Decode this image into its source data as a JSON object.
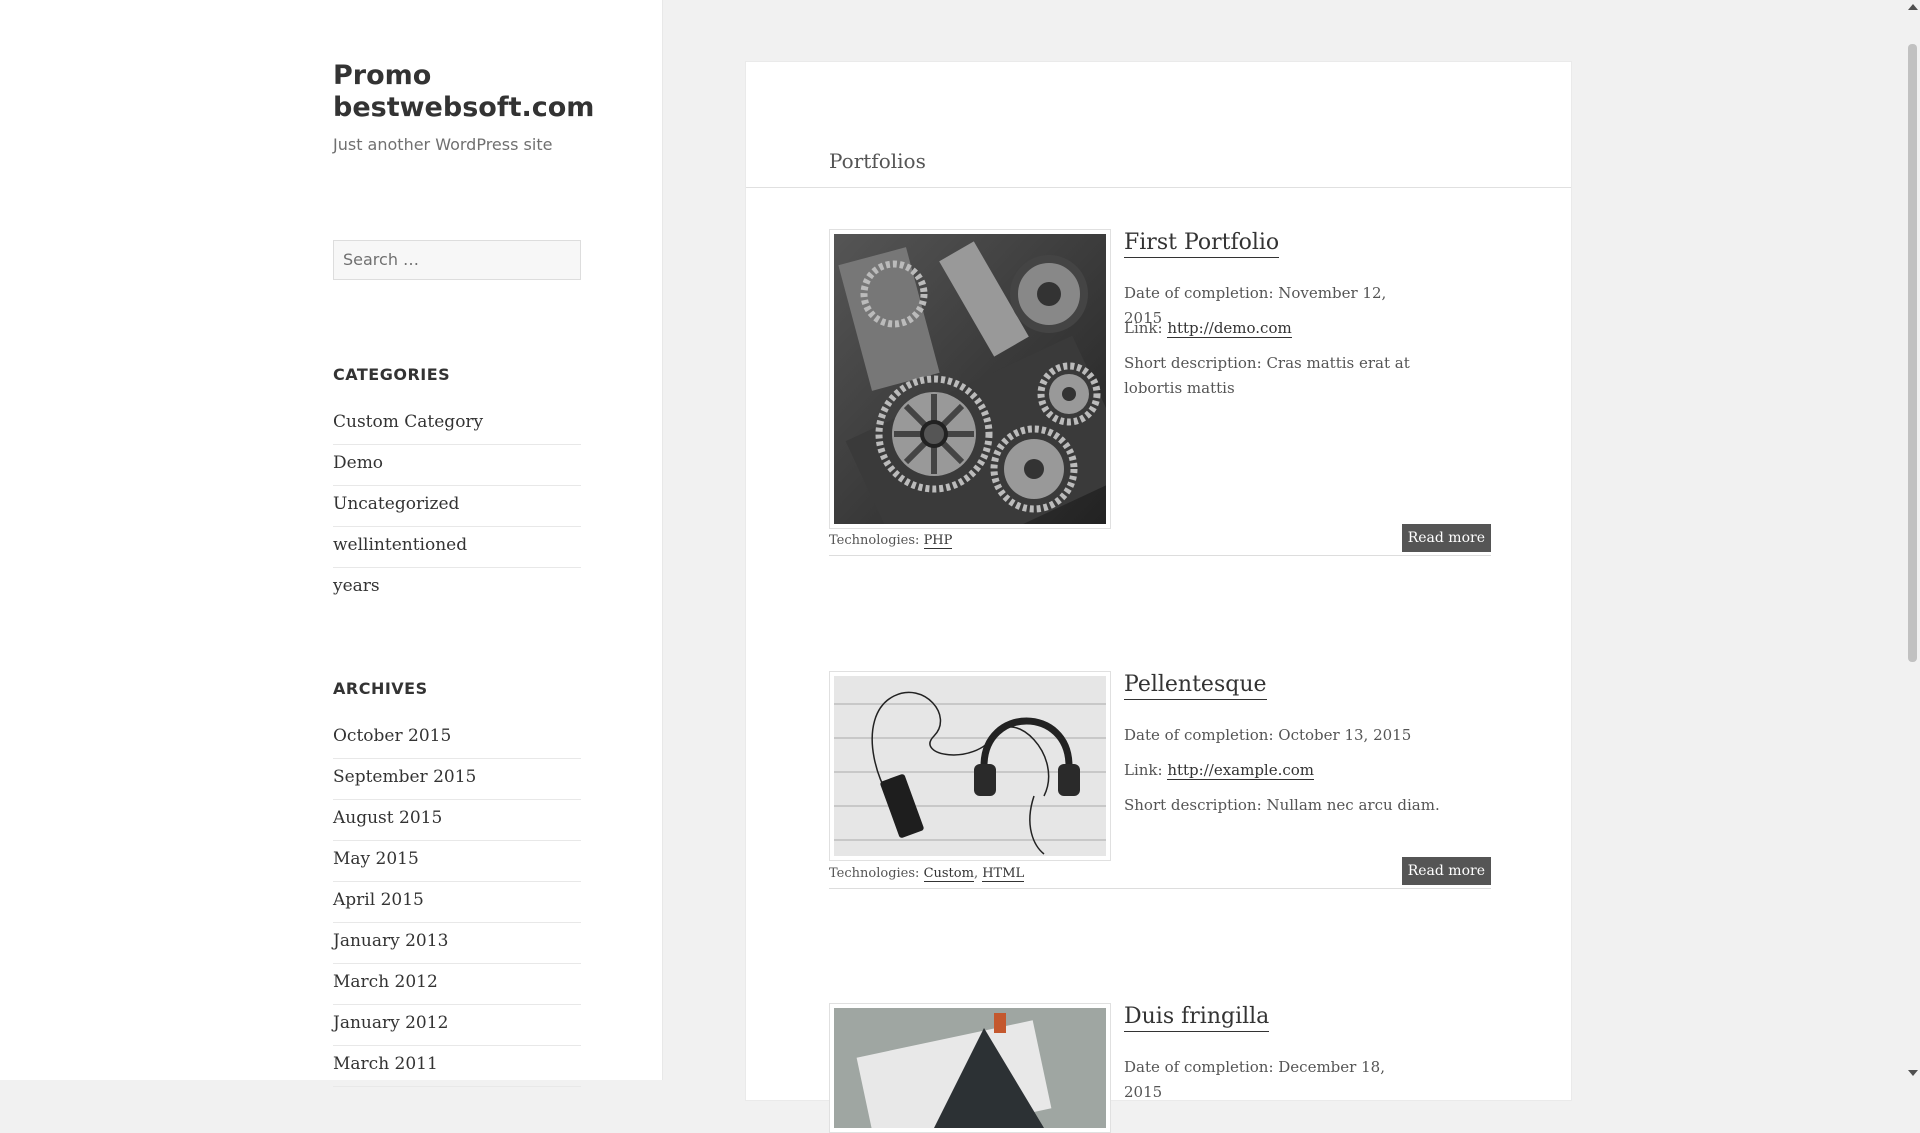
{
  "site": {
    "title": "Promo bestwebsoft.com",
    "description": "Just another WordPress site"
  },
  "search": {
    "placeholder": "Search …"
  },
  "categories": {
    "title": "CATEGORIES",
    "items": [
      "Custom Category",
      "Demo",
      "Uncategorized",
      "wellintentioned",
      "years"
    ]
  },
  "archives": {
    "title": "ARCHIVES",
    "items": [
      "October 2015",
      "September 2015",
      "August 2015",
      "May 2015",
      "April 2015",
      "January 2013",
      "March 2012",
      "January 2012",
      "March 2011"
    ]
  },
  "page": {
    "title": "Portfolios"
  },
  "portfolios": [
    {
      "title": "First Portfolio",
      "date_label": "Date of completion:",
      "date": "November 12, 2015",
      "link_label": "Link:",
      "link": "http://demo.com",
      "desc_label": "Short description:",
      "desc": "Cras mattis erat at lobortis mattis",
      "tech_label": "Technologies:",
      "technologies": [
        "PHP"
      ],
      "read_more": "Read more"
    },
    {
      "title": "Pellentesque",
      "date_label": "Date of completion:",
      "date": "October 13, 2015",
      "link_label": "Link:",
      "link": "http://example.com",
      "desc_label": "Short description:",
      "desc": "Nullam nec arcu diam.",
      "tech_label": "Technologies:",
      "technologies": [
        "Custom",
        "HTML"
      ],
      "read_more": "Read more"
    },
    {
      "title": "Duis fringilla",
      "date_label": "Date of completion:",
      "date": "December 18, 2015"
    }
  ]
}
